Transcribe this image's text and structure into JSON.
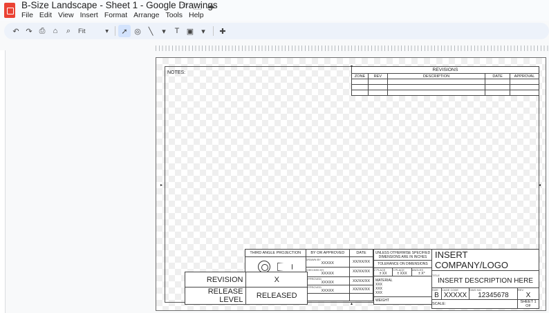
{
  "app": {
    "title": "B-Size Landscape - Sheet 1 - Google Drawings"
  },
  "menu": [
    "File",
    "Edit",
    "View",
    "Insert",
    "Format",
    "Arrange",
    "Tools",
    "Help"
  ],
  "toolbar": {
    "zoom": "Fit"
  },
  "drawing": {
    "notes": "NOTES:",
    "revisions": {
      "title": "REVISIONS",
      "headers": [
        "ZONE",
        "REV",
        "DESCRIPTION",
        "DATE",
        "APPROVAL"
      ]
    },
    "title_block": {
      "third_angle": "THIRD ANGLE PROJECTION",
      "by_or_approved": "BY OR APPROVED",
      "date": "DATE",
      "placeholder_x": "XXXXX",
      "placeholder_date": "XX/XX/XX",
      "unless": "UNLESS OTHERWISE SPECIFIED DIMENSIONS ARE IN INCHES",
      "tolerance": "TOLERANCE ON DIMENSIONS",
      "two_place": "2 PLACE",
      "three_place": "3 PLACE",
      "angles": "ANGLES",
      "two_place_value": "± XX",
      "three_place_value": "± XXX",
      "angles_value": "± X°",
      "material": "MATERIAL",
      "material_values": [
        "XXX",
        "XXX",
        "XXX"
      ],
      "weight": "WEIGHT",
      "company": "INSERT COMPANY/LOGO",
      "title": "TITLE",
      "description": "INSERT DESCRIPTION HERE",
      "size": "SIZE",
      "size_value": "B",
      "cage": "CAGE CODE",
      "cage_value": "XXXXX",
      "dwg": "DWG NO",
      "dwg_value": "12345678",
      "rev_label": "REV",
      "rev_value": "X",
      "scale": "SCALE:",
      "sheet": "SHEET 1 OF",
      "revision_label": "REVISION",
      "revision_value": "X",
      "release_label": "RELEASE LEVEL",
      "release_value": "RELEASED",
      "row_codes": [
        "DRAWN BY",
        "CHECKED BY",
        "APPROVED",
        "APPROVED"
      ]
    }
  }
}
